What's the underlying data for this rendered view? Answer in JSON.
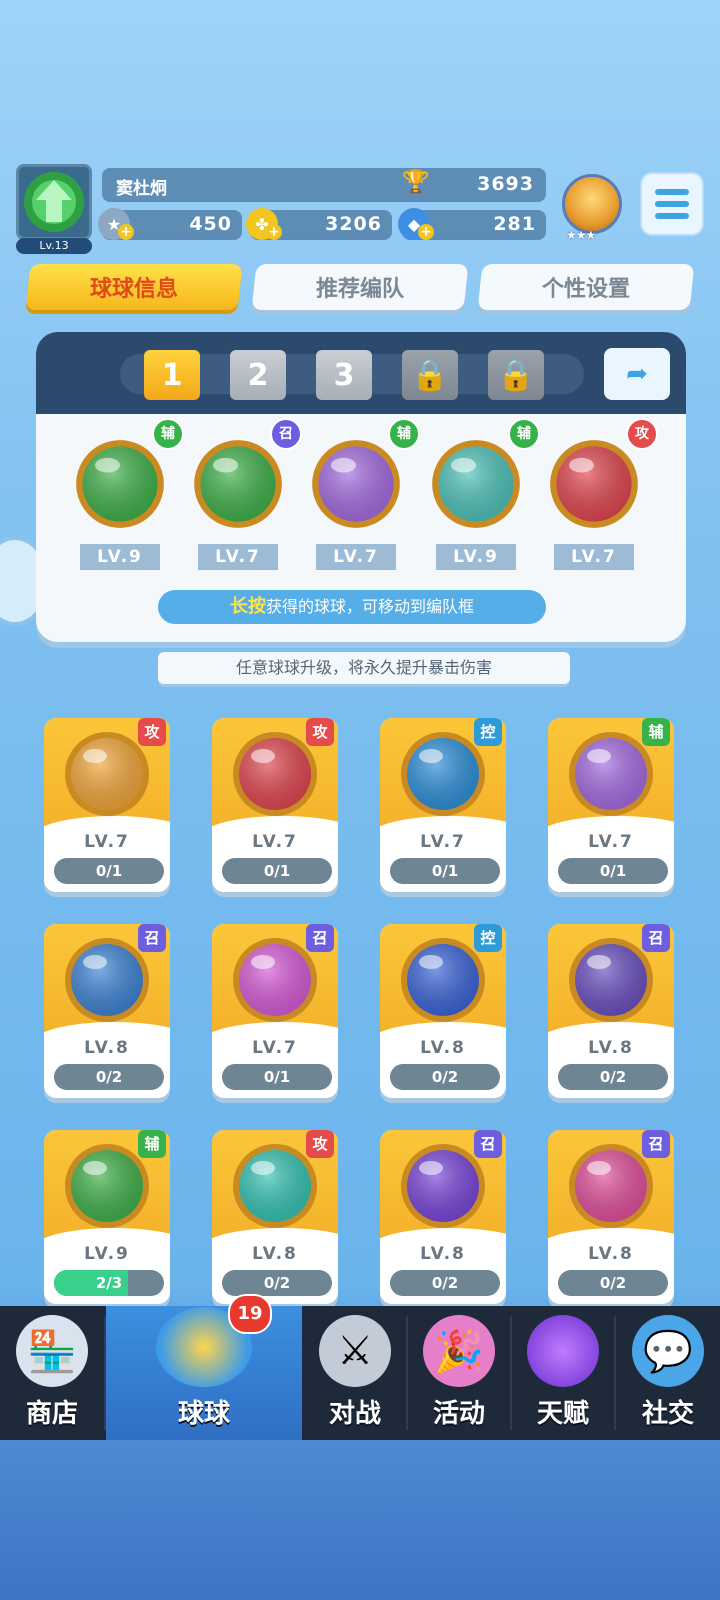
{
  "player": {
    "level": "Lv.13",
    "name": "窦杜炯",
    "trophies": "3693",
    "stamina": "450",
    "gold": "3206",
    "diamonds": "281"
  },
  "tabs": [
    "球球信息",
    "推荐编队",
    "个性设置"
  ],
  "team": {
    "slots": [
      "1",
      "2",
      "3"
    ],
    "balls": [
      {
        "type": "辅",
        "level": "LV.9",
        "color": "#3fb04a"
      },
      {
        "type": "召",
        "level": "LV.7",
        "color": "#3fb04a"
      },
      {
        "type": "辅",
        "level": "LV.7",
        "color": "#a46be0"
      },
      {
        "type": "辅",
        "level": "LV.9",
        "color": "#4dc2b8"
      },
      {
        "type": "攻",
        "level": "LV.7",
        "color": "#e0454f"
      }
    ],
    "hint_highlight": "长按",
    "hint_rest": "获得的球球，可移动到编队框"
  },
  "banner": "任意球球升级，将永久提升暴击伤害",
  "cards": [
    {
      "type": "攻",
      "level": "LV.7",
      "progress": "0/1",
      "ratio": 0,
      "color": "#f2a63a",
      "icon": "knight-helmet-icon"
    },
    {
      "type": "攻",
      "level": "LV.7",
      "progress": "0/1",
      "ratio": 0,
      "color": "#e0454f",
      "icon": "yin-yang-icon"
    },
    {
      "type": "控",
      "level": "LV.7",
      "progress": "0/1",
      "ratio": 0,
      "color": "#2d8fd8",
      "icon": "wave-icon"
    },
    {
      "type": "辅",
      "level": "LV.7",
      "progress": "0/1",
      "ratio": 0,
      "color": "#a46be0",
      "icon": "crowd-icon"
    },
    {
      "type": "召",
      "level": "LV.8",
      "progress": "0/2",
      "ratio": 0,
      "color": "#3d83d4",
      "icon": "vortex-icon"
    },
    {
      "type": "召",
      "level": "LV.7",
      "progress": "0/1",
      "ratio": 0,
      "color": "#d65ad6",
      "icon": "tree-icon"
    },
    {
      "type": "控",
      "level": "LV.8",
      "progress": "0/2",
      "ratio": 0,
      "color": "#3a63d6",
      "icon": "clock-icon"
    },
    {
      "type": "召",
      "level": "LV.8",
      "progress": "0/2",
      "ratio": 0,
      "color": "#6a4fc0",
      "icon": "ghost-icon"
    },
    {
      "type": "辅",
      "level": "LV.9",
      "progress": "2/3",
      "ratio": 0.67,
      "color": "#3fb04a",
      "icon": "arrow-up-icon"
    },
    {
      "type": "攻",
      "level": "LV.8",
      "progress": "0/2",
      "ratio": 0,
      "color": "#35c2b3",
      "icon": "tornado-icon"
    },
    {
      "type": "召",
      "level": "LV.8",
      "progress": "0/2",
      "ratio": 0,
      "color": "#7a45d8",
      "icon": "planet-icon"
    },
    {
      "type": "召",
      "level": "LV.8",
      "progress": "0/2",
      "ratio": 0,
      "color": "#e04f9a",
      "icon": "sword-icon"
    }
  ],
  "nav": {
    "items": [
      "商店",
      "球球",
      "对战",
      "活动",
      "天赋",
      "社交"
    ],
    "notification": "19"
  },
  "badge_colors": {
    "攻": "#e64b4b",
    "控": "#2e9bd9",
    "辅": "#36b24a",
    "召": "#6d5ee0"
  }
}
